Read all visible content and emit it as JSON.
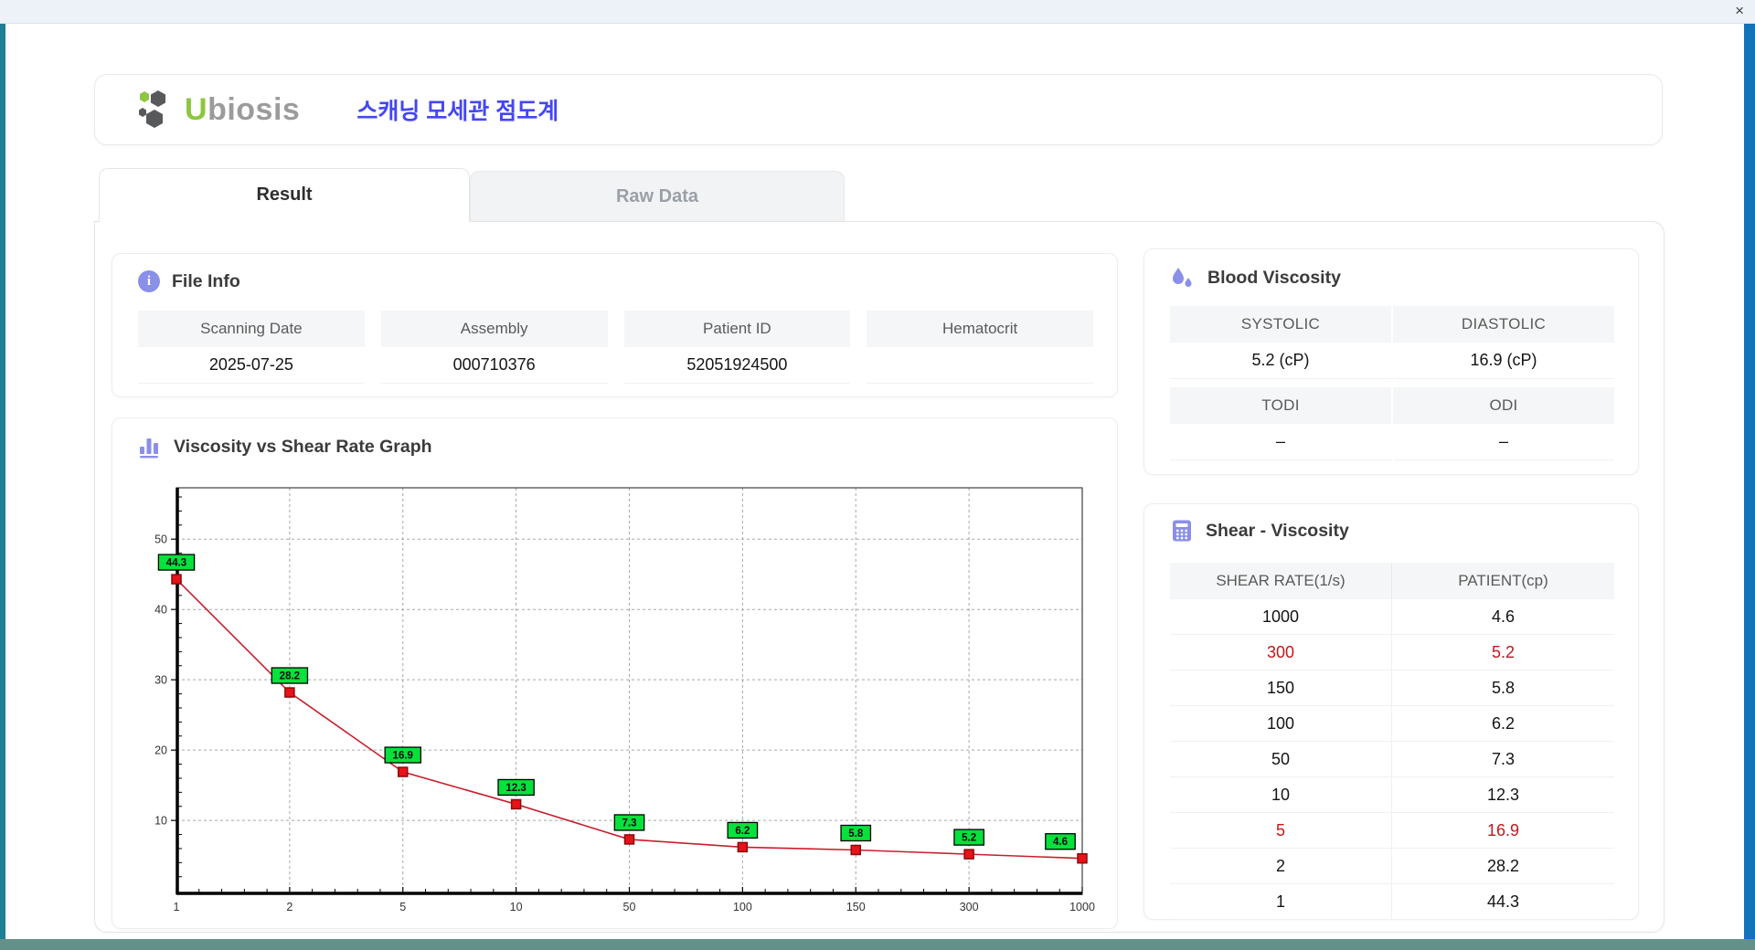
{
  "window": {
    "close_label": "×"
  },
  "header": {
    "logo_u": "U",
    "logo_rest": "biosis",
    "app_title_korean": "스캐닝 모세관 점도계"
  },
  "tabs": [
    {
      "label": "Result",
      "active": true
    },
    {
      "label": "Raw Data",
      "active": false
    }
  ],
  "file_info": {
    "heading": "File Info",
    "fields": [
      {
        "label": "Scanning Date",
        "value": "2025-07-25"
      },
      {
        "label": "Assembly",
        "value": "000710376"
      },
      {
        "label": "Patient ID",
        "value": "52051924500"
      },
      {
        "label": "Hematocrit",
        "value": ""
      }
    ]
  },
  "blood_viscosity": {
    "heading": "Blood Viscosity",
    "rows": [
      {
        "cells": [
          {
            "label": "SYSTOLIC",
            "value": "5.2 (cP)"
          },
          {
            "label": "DIASTOLIC",
            "value": "16.9 (cP)"
          }
        ]
      },
      {
        "cells": [
          {
            "label": "TODI",
            "value": "–"
          },
          {
            "label": "ODI",
            "value": "–"
          }
        ]
      }
    ]
  },
  "graph_section": {
    "heading": "Viscosity vs Shear Rate Graph"
  },
  "chart_data": {
    "type": "line",
    "title": "Viscosity vs Shear Rate Graph",
    "x_tick_labels": [
      "1",
      "2",
      "5",
      "10",
      "50",
      "100",
      "150",
      "300",
      "1000"
    ],
    "x_spacing": "equal-categorical",
    "y_ticks": [
      10,
      20,
      30,
      40,
      50
    ],
    "ylim": [
      -0.5,
      57.3
    ],
    "grid": "dashed",
    "legend": "none",
    "series": [
      {
        "name": "PATIENT(cp)",
        "x": [
          1,
          2,
          5,
          10,
          50,
          100,
          150,
          300,
          1000
        ],
        "values": [
          44.3,
          28.2,
          16.9,
          12.3,
          7.3,
          6.2,
          5.8,
          5.2,
          4.6
        ]
      }
    ],
    "point_labels": [
      "44.3",
      "28.2",
      "16.9",
      "12.3",
      "7.3",
      "6.2",
      "5.8",
      "5.2",
      "4.6"
    ],
    "colors": {
      "line": "#c81f2e",
      "marker_fill": "#e81218",
      "marker_border": "#8a0b0b",
      "label_box_fill": "#06e13c",
      "label_box_border": "#000000",
      "grid": "#a8a8a8",
      "axis": "#000000",
      "tick_text": "#333333"
    }
  },
  "shear_viscosity": {
    "heading": "Shear - Viscosity",
    "columns": [
      "SHEAR RATE(1/s)",
      "PATIENT(cp)"
    ],
    "highlight_color": "#c4161c",
    "rows": [
      {
        "shear_rate": "1000",
        "patient": "4.6",
        "highlight": false
      },
      {
        "shear_rate": "300",
        "patient": "5.2",
        "highlight": true
      },
      {
        "shear_rate": "150",
        "patient": "5.8",
        "highlight": false
      },
      {
        "shear_rate": "100",
        "patient": "6.2",
        "highlight": false
      },
      {
        "shear_rate": "50",
        "patient": "7.3",
        "highlight": false
      },
      {
        "shear_rate": "10",
        "patient": "12.3",
        "highlight": false
      },
      {
        "shear_rate": "5",
        "patient": "16.9",
        "highlight": true
      },
      {
        "shear_rate": "2",
        "patient": "28.2",
        "highlight": false
      },
      {
        "shear_rate": "1",
        "patient": "44.3",
        "highlight": false
      }
    ]
  },
  "accent_colors": {
    "section_icon": "#8a8fe9",
    "app_title": "#4446f5",
    "logo_green": "#8dc63f",
    "logo_gray": "#58595b"
  }
}
